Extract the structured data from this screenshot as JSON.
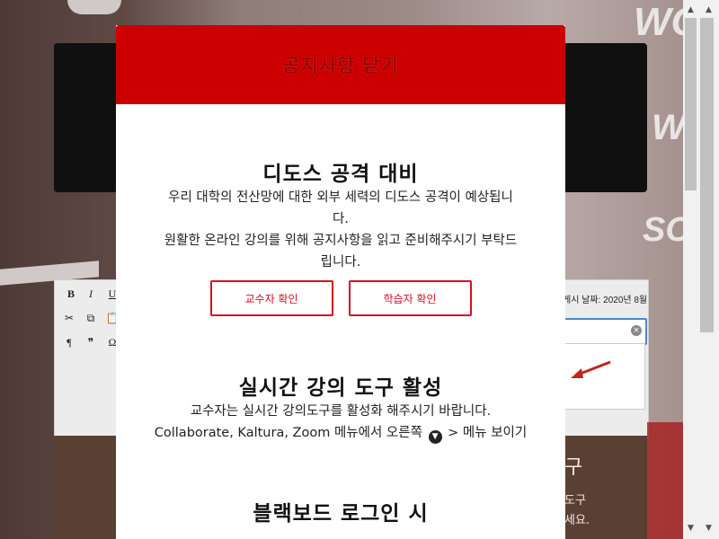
{
  "modal": {
    "close_label": "공지사항 닫기",
    "sections": [
      {
        "title": "디도스 공격 대비",
        "lines": [
          "우리 대학의 전산망에 대한 외부 세력의 디도스 공격이 예상됩니",
          "다.",
          "원활한 온라인 강의를 위해 공지사항을 읽고 준비해주시기 부탁드",
          "립니다."
        ],
        "buttons": [
          "교수자 확인",
          "학습자 확인"
        ]
      },
      {
        "title": "실시간 강의 도구 활성",
        "line1": "교수자는 실시간 강의도구를 활성화 해주시기 바랍니다.",
        "line2_before": "Collaborate, Kaltura, Zoom 메뉴에서 오른쪽",
        "line2_after": "> 메뉴 보이기"
      },
      {
        "title": "블랙보드 로그인 시"
      }
    ]
  },
  "background": {
    "toolbar": [
      "B",
      "I",
      "U",
      "✂",
      "⧉",
      "📋",
      "¶",
      "❞",
      "Ω"
    ],
    "post_date": "게시 날짜: 2020년 8월",
    "band_text_1": "구",
    "band_text_2": "도구",
    "band_text_3": "세요."
  },
  "icons": {
    "clear": "clear-icon",
    "chevron": "chevron-down-icon",
    "scroll_up": "scroll-up-arrow-icon",
    "scroll_down": "scroll-down-arrow-icon"
  },
  "colors": {
    "modal_header": "#cc0000",
    "button_border": "#d60f1f"
  }
}
